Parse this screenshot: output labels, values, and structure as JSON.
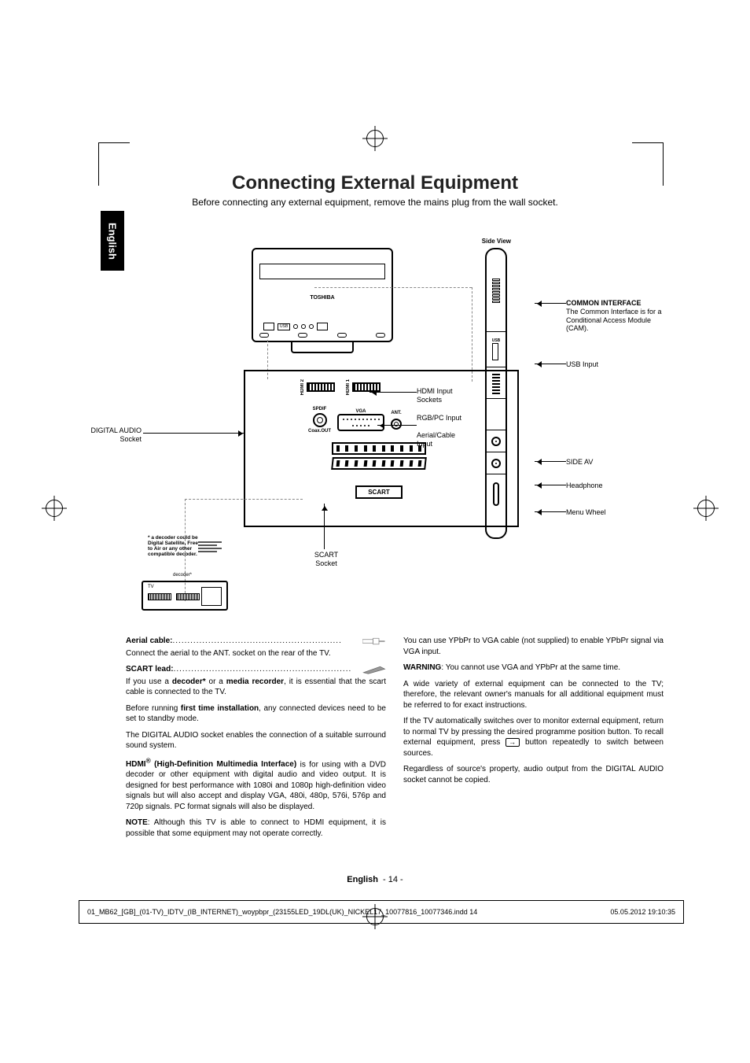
{
  "lang_tab": "English",
  "title": "Connecting External Equipment",
  "subtitle": "Before connecting any external equipment, remove the mains plug from the wall socket.",
  "diagram": {
    "tv_brand": "TOSHIBA",
    "usb_label": "USB",
    "rear": {
      "hdmi2": "HDMI 2",
      "hdmi1": "HDMI 1",
      "vga": "VGA",
      "ant": "ANT.",
      "spdif": "SPDIF",
      "coax_out": "Coax.OUT",
      "scart": "SCART"
    },
    "side_view_label": "Side View",
    "side_usb": "USB",
    "callouts": {
      "ci_title": "COMMON INTERFACE",
      "ci_body": "The Common Interface is for a Conditional Access Module (CAM).",
      "usb": "USB Input",
      "hdmi": "HDMI Input Sockets",
      "rgb": "RGB/PC Input",
      "aerial": "Aerial/Cable Input",
      "side_av": "SIDE AV",
      "headphone": "Headphone",
      "wheel": "Menu Wheel",
      "digital_audio": "DIGITAL AUDIO Socket",
      "scart_socket": "SCART Socket"
    },
    "decoder": {
      "note": "* a decoder could be Digital Satellite, Free to Air or any other compatible decoder.",
      "label": "decoder*",
      "tv": "TV"
    }
  },
  "left_col": {
    "aerial_label": "Aerial cable:",
    "aerial_body": "Connect the aerial to the ANT. socket on the rear of the TV.",
    "scart_label": "SCART lead:",
    "scart_p1a": "If you use a ",
    "scart_p1b": "decoder*",
    "scart_p1c": " or a ",
    "scart_p1d": "media recorder",
    "scart_p1e": ", it is essential that the scart cable is connected to the TV.",
    "p2a": "Before running ",
    "p2b": "first time installation",
    "p2c": ", any connected devices need to be set to standby mode.",
    "p3": "The DIGITAL AUDIO socket enables the connection of a suitable surround sound system.",
    "p4a": "HDMI",
    "p4sup": "®",
    "p4b": " (High-Definition Multimedia Interface)",
    "p4c": " is for using with a DVD decoder or other equipment with digital audio and video output. It is designed for best performance with 1080i and 1080p high-definition video signals but will also accept and display VGA, 480i, 480p, 576i, 576p and 720p signals. PC format signals will also be displayed.",
    "p5a": "NOTE",
    "p5b": ": Although this TV is able to connect to HDMI equipment, it is possible that some equipment may not operate correctly."
  },
  "right_col": {
    "p1": "You can use YPbPr to VGA cable (not supplied) to enable YPbPr signal via VGA input.",
    "p2a": "WARNING",
    "p2b": ": You cannot use VGA and YPbPr at the same time.",
    "p3": "A wide variety of external equipment can be connected to the TV; therefore, the relevant owner's manuals for all additional equipment must be referred to for exact instructions.",
    "p4a": "If the TV automatically switches over to monitor external equipment, return to normal TV by pressing the desired programme position button. To recall external equipment, press ",
    "p4b": " button repeatedly to switch between sources.",
    "p5": "Regardless of source's property, audio output from the DIGITAL AUDIO socket cannot be copied."
  },
  "footer": {
    "lang": "English",
    "page": "- 14 -"
  },
  "print": {
    "file": "01_MB62_[GB]_(01-TV)_IDTV_(IB_INTERNET)_woypbpr_(23155LED_19DL(UK)_NICKEL17_10077816_10077346.indd   14",
    "date": "05.05.2012   19:10:35"
  }
}
